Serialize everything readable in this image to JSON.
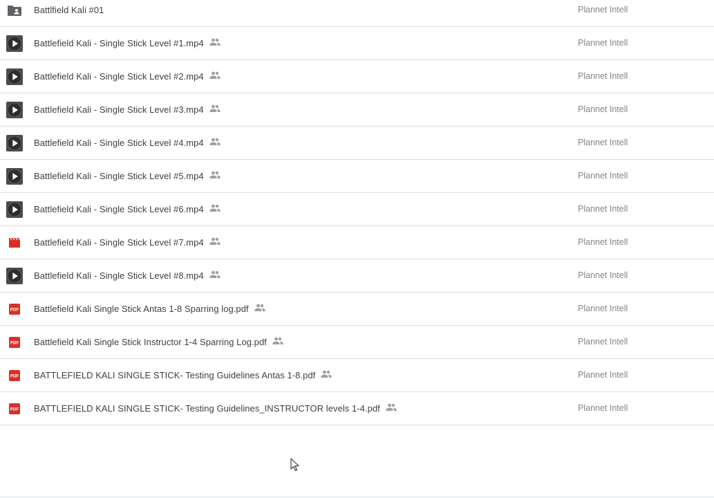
{
  "rows": [
    {
      "icon": "shared-folder-icon",
      "name": "Battlfield Kali #01",
      "shared": false,
      "owner": "Plannet Intell"
    },
    {
      "icon": "video-play-icon",
      "name": "Battlefield Kali - Single Stick Level #1.mp4",
      "shared": true,
      "owner": "Plannet Intell"
    },
    {
      "icon": "video-play-icon",
      "name": "Battlefield Kali - Single Stick Level #2.mp4",
      "shared": true,
      "owner": "Plannet Intell"
    },
    {
      "icon": "video-play-icon",
      "name": "Battlefield Kali - Single Stick Level #3.mp4",
      "shared": true,
      "owner": "Plannet Intell"
    },
    {
      "icon": "video-play-icon",
      "name": "Battlefield Kali - Single Stick Level #4.mp4",
      "shared": true,
      "owner": "Plannet Intell"
    },
    {
      "icon": "video-play-icon",
      "name": "Battlefield Kali - Single Stick Level #5.mp4",
      "shared": true,
      "owner": "Plannet Intell"
    },
    {
      "icon": "video-play-icon",
      "name": "Battlefield Kali - Single Stick Level #6.mp4",
      "shared": true,
      "owner": "Plannet Intell"
    },
    {
      "icon": "video-file-icon",
      "name": "Battlefield Kali - Single Stick Level #7.mp4",
      "shared": true,
      "owner": "Plannet Intell"
    },
    {
      "icon": "video-play-icon",
      "name": "Battlefield Kali - Single Stick Level #8.mp4",
      "shared": true,
      "owner": "Plannet Intell"
    },
    {
      "icon": "pdf-icon",
      "name": "Battlefield Kali Single Stick Antas 1-8 Sparring log.pdf",
      "shared": true,
      "owner": "Plannet Intell"
    },
    {
      "icon": "pdf-icon",
      "name": "Battlefield Kali Single Stick Instructor 1-4 Sparring Log.pdf",
      "shared": true,
      "owner": "Plannet Intell"
    },
    {
      "icon": "pdf-icon",
      "name": "BATTLEFIELD KALI SINGLE STICK- Testing Guidelines Antas 1-8.pdf",
      "shared": true,
      "owner": "Plannet Intell"
    },
    {
      "icon": "pdf-icon",
      "name": "BATTLEFIELD KALI SINGLE STICK- Testing Guidelines_INSTRUCTOR levels 1-4.pdf",
      "shared": true,
      "owner": "Plannet Intell"
    }
  ],
  "pdf_badge_text": "PDF",
  "colors": {
    "folder": "#5f6368",
    "video_play_bg": "#2d2d2d",
    "video_file": "#d93025",
    "pdf": "#d93025",
    "shared_icon": "#9aa0a6",
    "owner_text": "#80868b",
    "name_text": "#3c4043",
    "divider": "#dadce0"
  }
}
